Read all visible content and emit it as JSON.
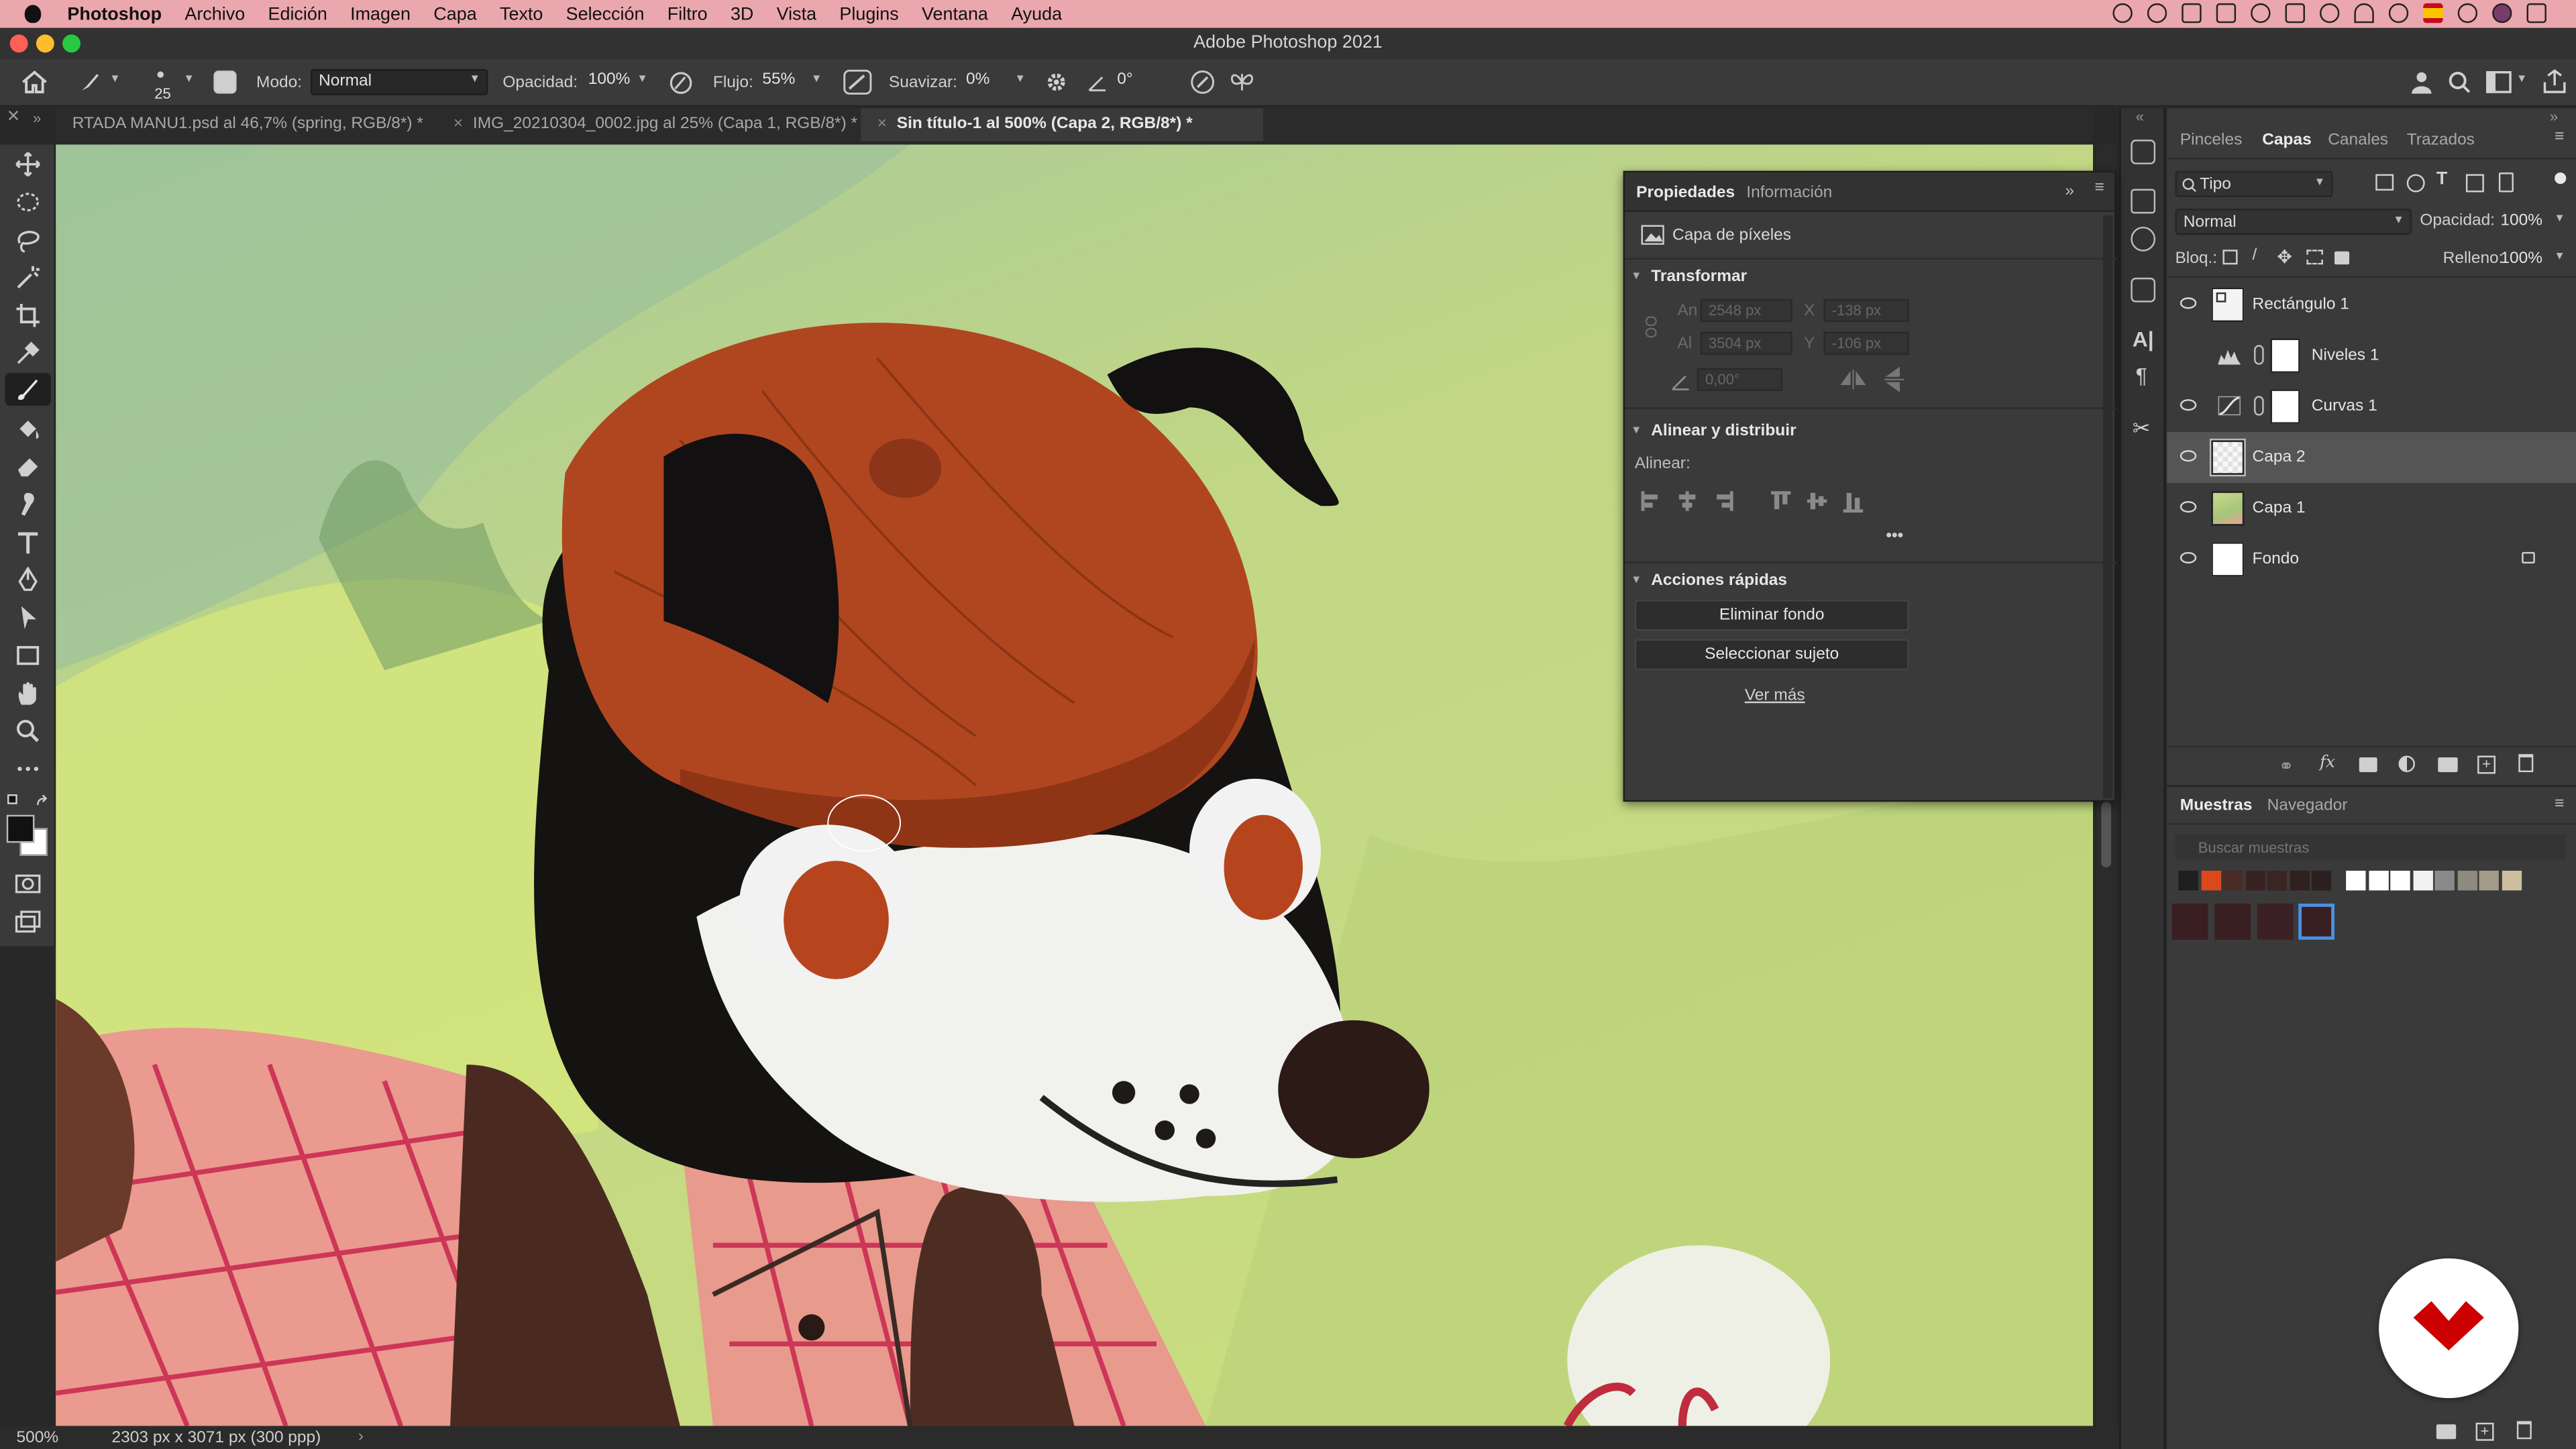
{
  "menubar": {
    "app": "Photoshop",
    "items": [
      "Archivo",
      "Edición",
      "Imagen",
      "Capa",
      "Texto",
      "Selección",
      "Filtro",
      "3D",
      "Vista",
      "Plugins",
      "Ventana",
      "Ayuda"
    ]
  },
  "window": {
    "title": "Adobe Photoshop 2021"
  },
  "options": {
    "brush_size": "25",
    "mode_label": "Modo:",
    "mode_value": "Normal",
    "opacity_label": "Opacidad:",
    "opacity_value": "100%",
    "flow_label": "Flujo:",
    "flow_value": "55%",
    "smooth_label": "Suavizar:",
    "smooth_value": "0%",
    "angle_value": "0°"
  },
  "tabs": [
    {
      "label": "RTADA MANU1.psd al 46,7% (spring, RGB/8*) *",
      "active": false
    },
    {
      "label": "IMG_20210304_0002.jpg al 25% (Capa 1, RGB/8*) *",
      "active": false
    },
    {
      "label": "Sin título-1 al 500% (Capa 2, RGB/8*) *",
      "active": true
    }
  ],
  "status": {
    "zoom": "500%",
    "doc_info": "2303 px x 3071 px (300 ppp)"
  },
  "properties": {
    "tabs": [
      "Propiedades",
      "Información"
    ],
    "layer_type": "Capa de píxeles",
    "transform": {
      "title": "Transformar",
      "w_label": "An",
      "w_value": "2548 px",
      "x_label": "X",
      "x_value": "-138 px",
      "h_label": "Al",
      "h_value": "3504 px",
      "y_label": "Y",
      "y_value": "-106 px",
      "angle_value": "0,00°"
    },
    "align": {
      "title": "Alinear y distribuir",
      "label": "Alinear:",
      "more": "•••"
    },
    "quick_actions": {
      "title": "Acciones rápidas",
      "remove_bg": "Eliminar fondo",
      "select_subject": "Seleccionar sujeto",
      "see_more": "Ver más"
    }
  },
  "layers_panel": {
    "tabs": [
      "Pinceles",
      "Capas",
      "Canales",
      "Trazados"
    ],
    "filter_value": "Tipo",
    "blend_value": "Normal",
    "opacity_label": "Opacidad:",
    "opacity_value": "100%",
    "lock_label": "Bloq.:",
    "fill_label": "Relleno:",
    "fill_value": "100%",
    "layers": [
      {
        "name": "Rectángulo 1",
        "visible": true,
        "selected": false,
        "kind": "shape"
      },
      {
        "name": "Niveles 1",
        "visible": false,
        "selected": false,
        "kind": "levels"
      },
      {
        "name": "Curvas 1",
        "visible": true,
        "selected": false,
        "kind": "curves"
      },
      {
        "name": "Capa 2",
        "visible": true,
        "selected": true,
        "kind": "pixel"
      },
      {
        "name": "Capa 1",
        "visible": true,
        "selected": false,
        "kind": "image"
      },
      {
        "name": "Fondo",
        "visible": true,
        "selected": false,
        "kind": "background",
        "locked": true
      }
    ],
    "footer_fx": "fx"
  },
  "swatches_panel": {
    "tabs": [
      "Muestras",
      "Navegador"
    ],
    "search_placeholder": "Buscar muestras",
    "row1": [
      "#1e1e1e",
      "#d9491c",
      "#4a2a24",
      "#3b2222",
      "#3a2424",
      "#312020",
      "#2c2020",
      "#ffffff",
      "#ffffff",
      "#ffffff",
      "#f2f2f2",
      "#8a8a8a",
      "#8f8a7e",
      "#a39a88",
      "#cdbf9f"
    ],
    "row2": [
      "#3a1f22",
      "#3a1f22",
      "#3b2126",
      "#3a1f22"
    ]
  },
  "colors": {
    "accent_selection": "#4a90e2",
    "brand_red": "#cc0000",
    "menubar_pink": "#eaa7ad"
  }
}
